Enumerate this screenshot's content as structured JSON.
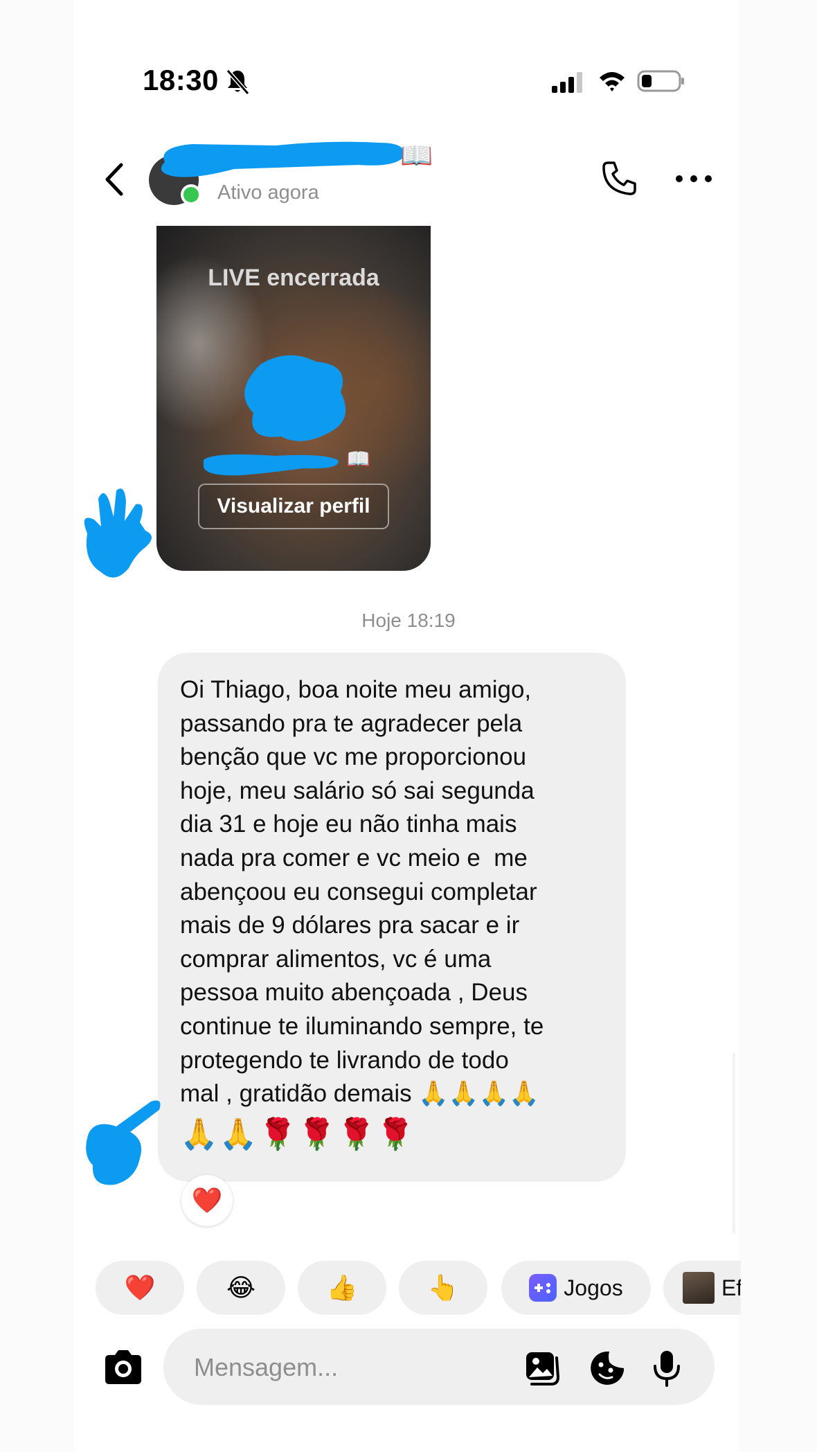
{
  "status_bar": {
    "time": "18:30"
  },
  "header": {
    "contact_emoji": "📖",
    "status": "Ativo agora"
  },
  "live_card": {
    "title": "LIVE encerrada",
    "name_emoji": "📖",
    "button_label": "Visualizar perfil"
  },
  "timestamp": "Hoje 18:19",
  "message": {
    "text": "Oi Thiago, boa noite meu amigo,\npassando pra te agradecer pela\nbenção que vc me proporcionou\nhoje, meu salário só sai segunda\ndia 31 e hoje eu não tinha mais\nnada pra comer e vc meio e  me\nabençoou eu consegui completar\nmais de 9 dólares pra sacar e ir\ncomprar alimentos, vc é uma\npessoa muito abençoada , Deus\ncontinue te iluminando sempre, te\nprotegendo te livrando de todo\nmal , gratidão demais 🙏🙏🙏🙏",
    "emoji_line": "🙏🙏🌹🌹🌹🌹",
    "reaction": "❤️"
  },
  "quick_reactions": [
    {
      "emoji": "❤️"
    },
    {
      "emoji": "😂"
    },
    {
      "emoji": "👍"
    },
    {
      "emoji": "👆"
    }
  ],
  "quick_actions": {
    "games_label": "Jogos",
    "effects_label": "Ef"
  },
  "composer": {
    "placeholder": "Mensagem..."
  },
  "colors": {
    "online": "#35c74f",
    "bubble": "#efefef",
    "redaction": "#0d9bf2",
    "muted_text": "#8e8e8e"
  }
}
